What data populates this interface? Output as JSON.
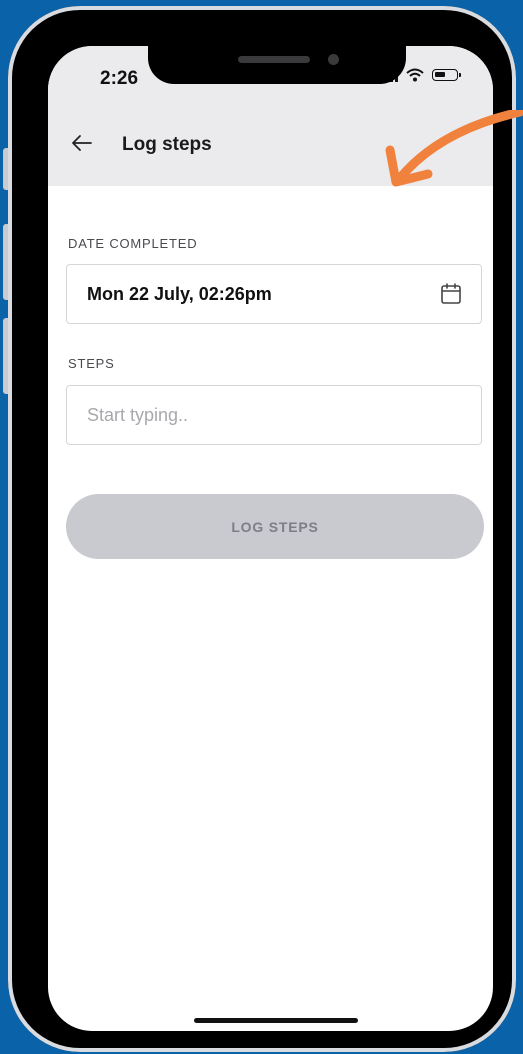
{
  "status_bar": {
    "time": "2:26"
  },
  "header": {
    "title": "Log steps",
    "back_icon": "arrow-left-icon"
  },
  "form": {
    "date_label": "DATE COMPLETED",
    "date_value": "Mon 22 July, 02:26pm",
    "date_icon": "calendar-icon",
    "steps_label": "STEPS",
    "steps_value": "",
    "steps_placeholder": "Start typing..",
    "submit_label": "LOG STEPS"
  },
  "colors": {
    "background": "#0a63a8",
    "annotation_arrow": "#f0823d",
    "topbar": "#ebebed",
    "button_disabled": "#c9cad0"
  }
}
